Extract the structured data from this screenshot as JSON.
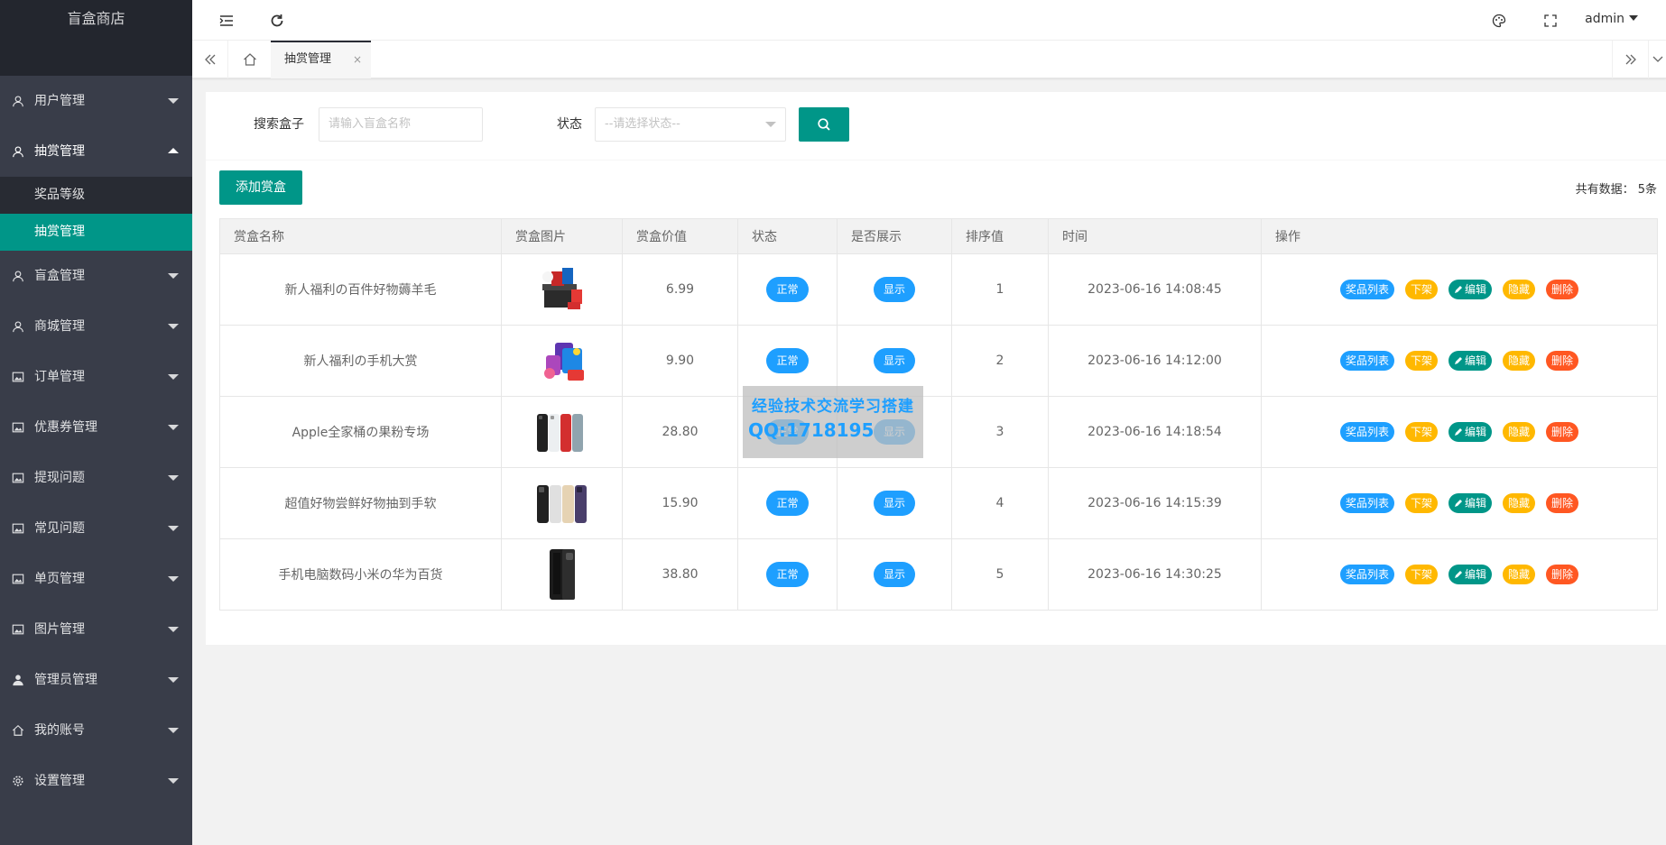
{
  "app": {
    "title": "盲盒商店"
  },
  "sidebar": {
    "items": [
      {
        "label": "用户管理",
        "icon": "user-icon"
      },
      {
        "label": "抽赏管理",
        "icon": "user-icon",
        "open": true,
        "children": [
          {
            "label": "奖品等级"
          },
          {
            "label": "抽赏管理",
            "active": true
          }
        ]
      },
      {
        "label": "盲盒管理",
        "icon": "user-icon"
      },
      {
        "label": "商城管理",
        "icon": "user-icon"
      },
      {
        "label": "订单管理",
        "icon": "image-icon"
      },
      {
        "label": "优惠券管理",
        "icon": "image-icon"
      },
      {
        "label": "提现问题",
        "icon": "image-icon"
      },
      {
        "label": "常见问题",
        "icon": "image-icon"
      },
      {
        "label": "单页管理",
        "icon": "image-icon"
      },
      {
        "label": "图片管理",
        "icon": "image-icon"
      },
      {
        "label": "管理员管理",
        "icon": "person-icon"
      },
      {
        "label": "我的账号",
        "icon": "home-icon"
      },
      {
        "label": "设置管理",
        "icon": "gear-icon"
      }
    ]
  },
  "header": {
    "user": "admin"
  },
  "tabs": {
    "active_label": "抽赏管理",
    "close": "×"
  },
  "search": {
    "box_label": "搜索盒子",
    "box_placeholder": "请输入盲盒名称",
    "status_label": "状态",
    "status_placeholder": "--请选择状态--"
  },
  "toolbar": {
    "add_label": "添加赏盒",
    "total_text": "共有数据：  5条"
  },
  "table": {
    "columns": [
      "赏盒名称",
      "赏盒图片",
      "赏盒价值",
      "状态",
      "是否展示",
      "排序值",
      "时间",
      "操作"
    ],
    "rows": [
      {
        "name": "新人福利の百件好物薅羊毛",
        "price": "6.99",
        "status": "正常",
        "display": "显示",
        "sort": "1",
        "time": "2023-06-16 14:08:45",
        "image": "gift-box"
      },
      {
        "name": "新人福利の手机大赏",
        "price": "9.90",
        "status": "正常",
        "display": "显示",
        "sort": "2",
        "time": "2023-06-16 14:12:00",
        "image": "phone-bundle"
      },
      {
        "name": "Apple全家桶の果粉专场",
        "price": "28.80",
        "status": "正常",
        "display": "显示",
        "sort": "3",
        "time": "2023-06-16 14:18:54",
        "image": "iphones-color"
      },
      {
        "name": "超值好物尝鲜好物抽到手软",
        "price": "15.90",
        "status": "正常",
        "display": "显示",
        "sort": "4",
        "time": "2023-06-16 14:15:39",
        "image": "iphones-pro"
      },
      {
        "name": "手机电脑数码小米の华为百货",
        "price": "38.80",
        "status": "正常",
        "display": "显示",
        "sort": "5",
        "time": "2023-06-16 14:30:25",
        "image": "fold-phone"
      }
    ],
    "actions": {
      "prize_list": "奖品列表",
      "off_shelf": "下架",
      "edit": "编辑",
      "hide": "隐藏",
      "delete": "删除"
    }
  },
  "watermark": {
    "line1": "经验技术交流学习搭建",
    "line2": "QQ:1718195"
  },
  "colors": {
    "primary": "#009688",
    "sidebar": "#393D49",
    "blue": "#1E9FFF",
    "yellow": "#FFB800",
    "red": "#FF5722"
  }
}
